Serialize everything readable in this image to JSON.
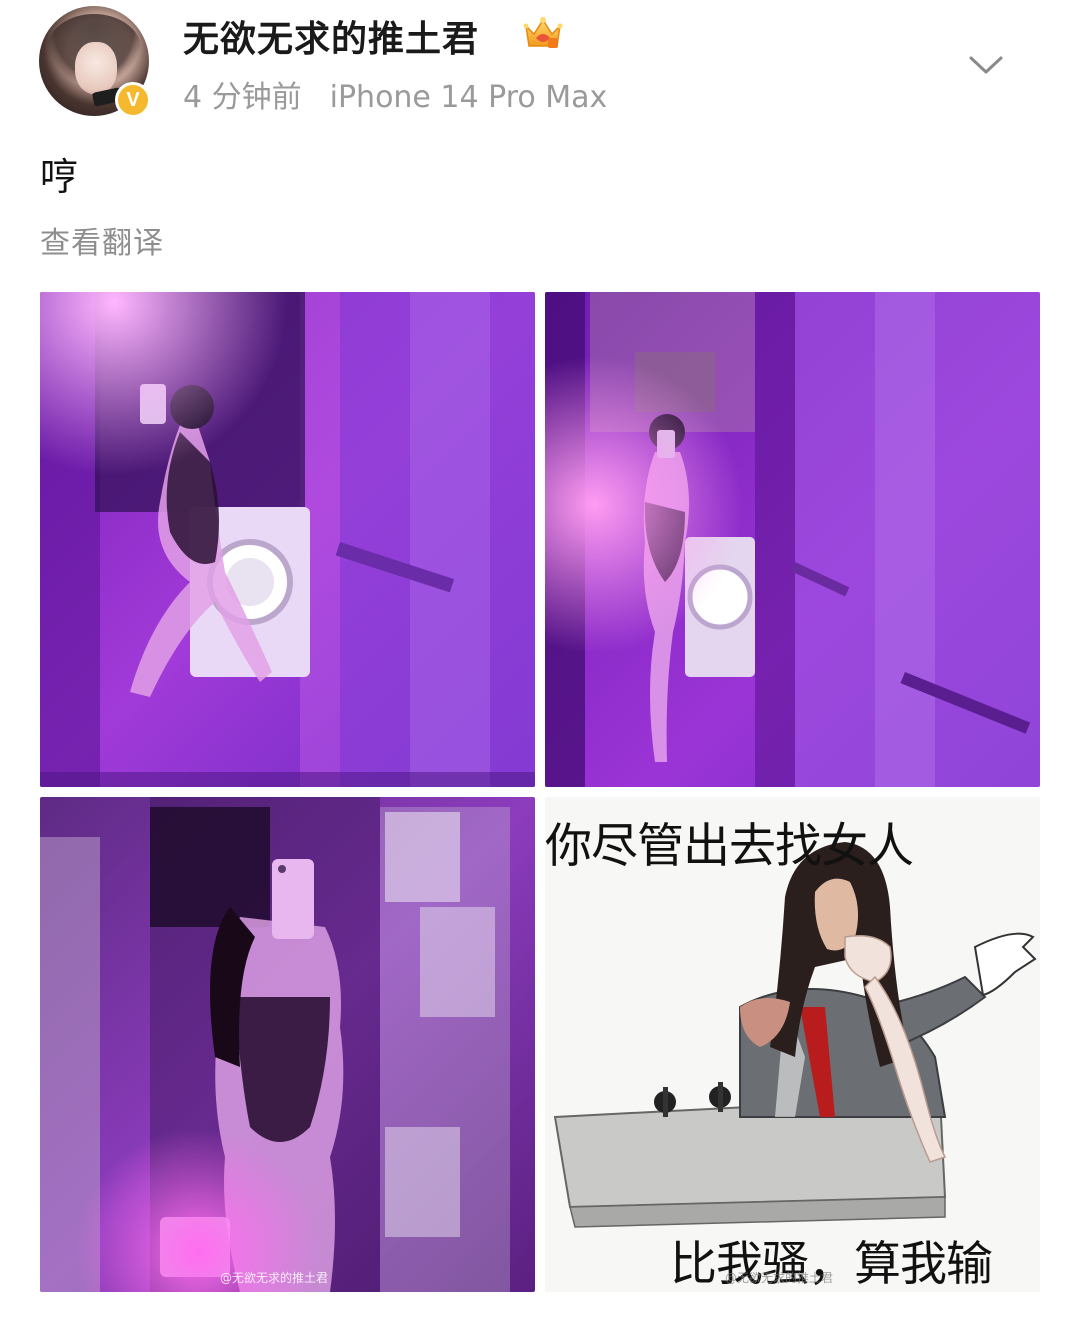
{
  "post": {
    "username": "无欲无求的推土君",
    "verified_badge": "V",
    "time": "4 分钟前",
    "device": "iPhone 14 Pro Max",
    "text": "哼",
    "translate_link": "查看翻译"
  },
  "icons": {
    "vip": "vip-crown-icon",
    "more": "chevron-down-icon"
  },
  "images": [
    {
      "alt": "purple-lit mirror selfie 1"
    },
    {
      "alt": "purple-lit mirror selfie 2"
    },
    {
      "alt": "purple-lit mirror selfie 3",
      "watermark": "@无欲无求的推土君"
    },
    {
      "alt": "meme image",
      "caption_top": "你尽管出去找女人",
      "caption_bottom": "比我骚，算我输",
      "watermark": "@无欲无求的推土君"
    }
  ],
  "colors": {
    "accent_purple": "#9b2ad6",
    "badge_gold": "#f5b92e",
    "meta_gray": "#9a9a9a"
  }
}
